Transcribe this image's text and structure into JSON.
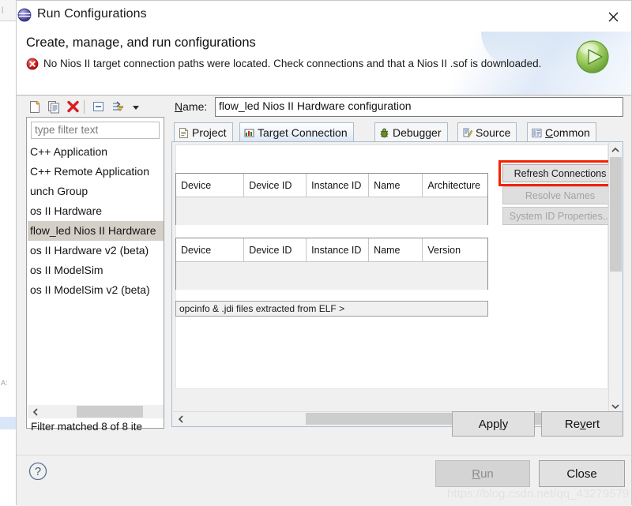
{
  "window": {
    "title": "Run Configurations",
    "icon": "eclipse-globe-icon",
    "close_label": "✕"
  },
  "header": {
    "title": "Create, manage, and run configurations",
    "message": "No Nios II target connection paths were located. Check connections and that a Nios II .sof is downloaded.",
    "status_icon": "error-icon",
    "run_icon": "run-play-icon"
  },
  "sidebar": {
    "toolbar": [
      {
        "name": "new-launch-configuration-icon",
        "label": "New launch configuration"
      },
      {
        "name": "duplicate-launch-configuration-icon",
        "label": "Duplicate"
      },
      {
        "name": "delete-launch-configuration-icon",
        "label": "Delete"
      },
      {
        "name": "collapse-all-icon",
        "label": "Collapse All"
      },
      {
        "name": "filter-launch-configurations-icon",
        "label": "Filter"
      },
      {
        "name": "view-menu-chevron-down-icon",
        "label": "View Menu"
      }
    ],
    "filter_placeholder": "type filter text",
    "filter_value": "",
    "items": [
      {
        "label": "C++ Application",
        "selected": false
      },
      {
        "label": "C++ Remote Application",
        "selected": false
      },
      {
        "label": "unch Group",
        "selected": false
      },
      {
        "label": "os II Hardware",
        "selected": false
      },
      {
        "label": "flow_led Nios II Hardware",
        "selected": true
      },
      {
        "label": "os II Hardware v2 (beta)",
        "selected": false
      },
      {
        "label": "os II ModelSim",
        "selected": false
      },
      {
        "label": "os II ModelSim v2 (beta)",
        "selected": false
      }
    ],
    "status": "Filter matched 8 of 8 ite"
  },
  "main": {
    "name_label_pre": "N",
    "name_label_mnemonic": "N",
    "name_label_post": "ame:",
    "name_value": "flow_led Nios II Hardware configuration",
    "tabs": [
      {
        "label": "Project",
        "icon": "project-file-icon",
        "active": false,
        "mnemonic": ""
      },
      {
        "label": "Target Connection",
        "icon": "target-connection-icon",
        "active": true,
        "mnemonic": ""
      },
      {
        "label": "Debugger",
        "icon": "debugger-bug-icon",
        "active": false,
        "mnemonic": ""
      },
      {
        "label": "Source",
        "icon": "source-icon",
        "active": false,
        "mnemonic": ""
      },
      {
        "label": "Common",
        "icon": "common-icon",
        "active": false,
        "mnemonic": "C"
      }
    ],
    "processors_table": {
      "columns": [
        "Device",
        "Device ID",
        "Instance ID",
        "Name",
        "Architecture"
      ],
      "rows": []
    },
    "byte_stream_table": {
      "columns": [
        "Device",
        "Device ID",
        "Instance ID",
        "Name",
        "Version"
      ],
      "rows": []
    },
    "elf_field_value": "opcinfo & .jdi files extracted from ELF >",
    "side_buttons": [
      {
        "label": "Refresh Connections",
        "enabled": true,
        "highlighted": true
      },
      {
        "label": "Resolve Names",
        "enabled": false,
        "highlighted": false
      },
      {
        "label": "System ID Properties...",
        "enabled": false,
        "highlighted": false
      }
    ],
    "apply_label_pre": "App",
    "apply_label_mnemonic": "l",
    "apply_label_post": "y",
    "revert_label_pre": "Re",
    "revert_label_mnemonic": "v",
    "revert_label_post": "ert"
  },
  "footer": {
    "help_icon": "help-question-icon",
    "run_pre": "",
    "run_mnemonic": "R",
    "run_post": "un",
    "run_enabled": false,
    "close_label": "Close",
    "watermark": "https://blog.csdn.net/qq_43279579"
  },
  "colors": {
    "accent_blue": "#dbe7f4",
    "highlight_red": "#f42100",
    "error_red": "#cc2222",
    "run_green": "#7cc043",
    "selection_gray": "#d4d0c8"
  },
  "scrollbars": {
    "vertical_up": "⌃",
    "vertical_down": "⌄",
    "horizontal_left": "‹",
    "horizontal_right": "›"
  }
}
